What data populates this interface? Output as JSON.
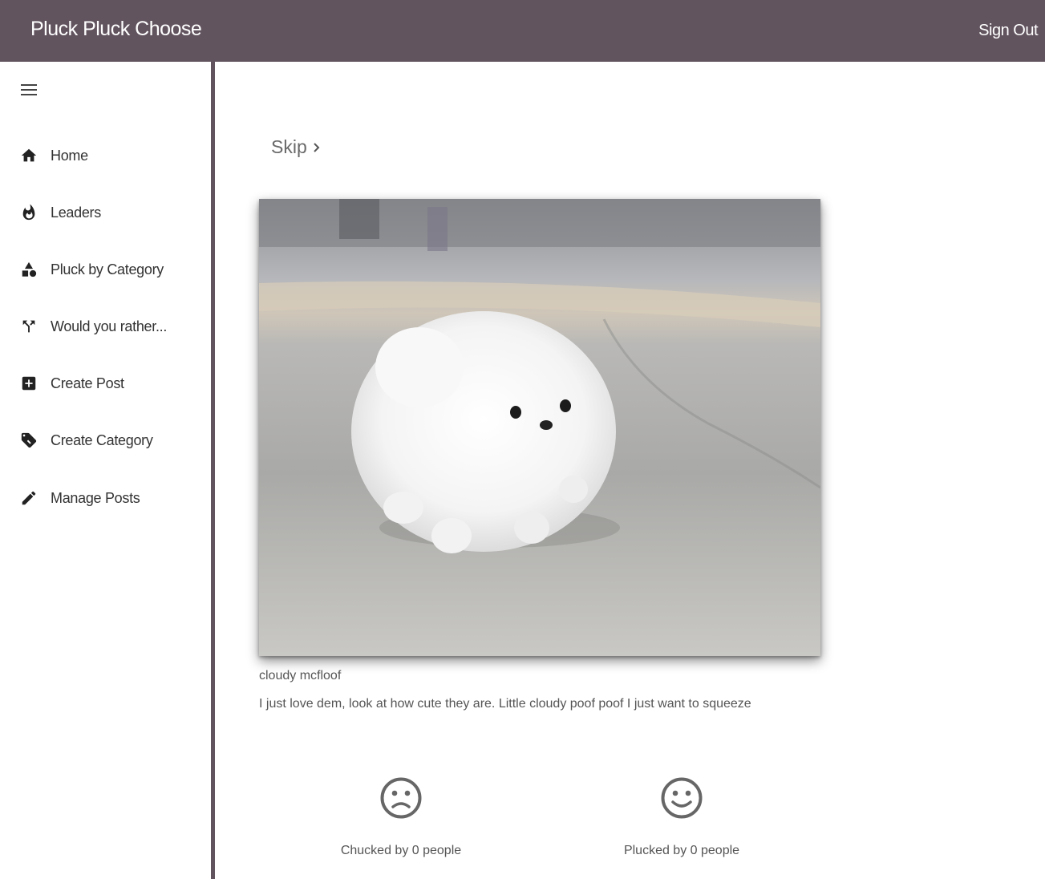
{
  "app": {
    "title": "Pluck Pluck Choose",
    "sign_out_label": "Sign Out",
    "accent_color": "#62545f"
  },
  "sidebar": {
    "items": [
      {
        "label": "Home",
        "icon": "home-icon"
      },
      {
        "label": "Leaders",
        "icon": "fire-icon"
      },
      {
        "label": "Pluck by Category",
        "icon": "category-icon"
      },
      {
        "label": "Would you rather...",
        "icon": "call-split-icon"
      },
      {
        "label": "Create Post",
        "icon": "add-box-icon"
      },
      {
        "label": "Create Category",
        "icon": "tags-icon"
      },
      {
        "label": "Manage Posts",
        "icon": "edit-icon"
      }
    ]
  },
  "main": {
    "skip_label": "Skip",
    "post": {
      "title": "cloudy mcfloof",
      "description": "I just love dem, look at how cute they are. Little cloudy poof poof I just want to squeeze",
      "image": "fluffy white pomeranian puppy"
    },
    "votes": {
      "chuck_label": "Chucked by 0 people",
      "pluck_label": "Plucked by 0 people"
    }
  }
}
